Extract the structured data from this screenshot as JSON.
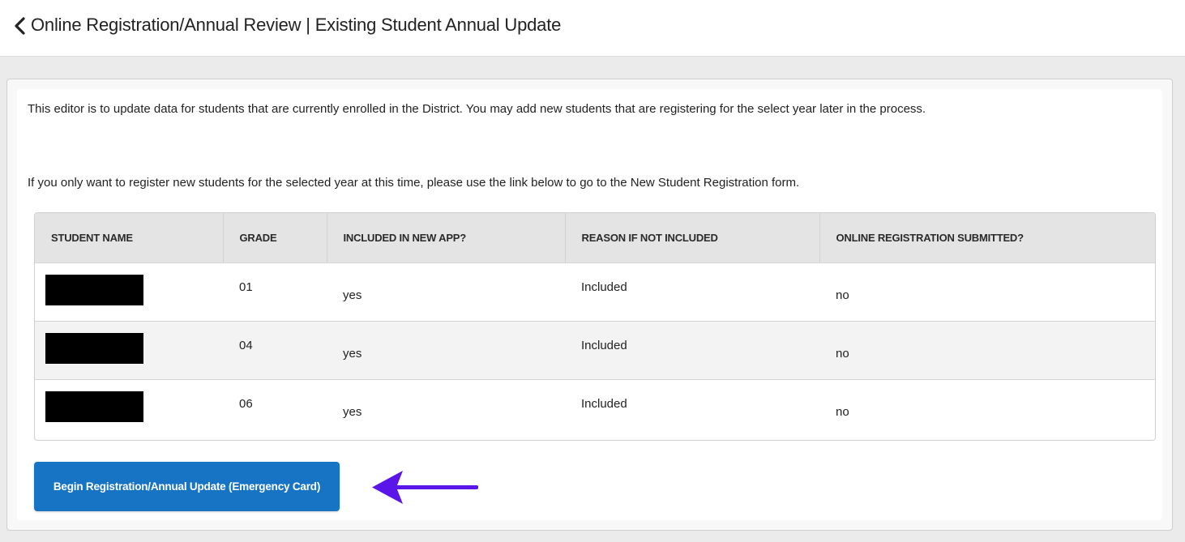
{
  "header": {
    "back_icon": "chevron-left-icon",
    "title": "Online Registration/Annual Review | Existing Student Annual Update"
  },
  "intro": {
    "line1": "This editor is to update data for students that are currently enrolled in the District. You may add new students that are registering for the select year later in the process.",
    "line2": "If you only want to register new students for the selected year at this time, please use the link below to go to the New Student Registration form."
  },
  "table": {
    "headers": [
      "STUDENT NAME",
      "GRADE",
      "INCLUDED IN NEW APP?",
      "REASON IF NOT INCLUDED",
      "ONLINE REGISTRATION SUBMITTED?"
    ],
    "rows": [
      {
        "grade": "01",
        "included": "yes",
        "reason": "Included",
        "submitted": "no"
      },
      {
        "grade": "04",
        "included": "yes",
        "reason": "Included",
        "submitted": "no"
      },
      {
        "grade": "06",
        "included": "yes",
        "reason": "Included",
        "submitted": "no"
      }
    ]
  },
  "actions": {
    "begin_label": "Begin Registration/Annual Update (Emergency Card)",
    "annotation_arrow_icon": "left-arrow-icon"
  },
  "colors": {
    "button_blue": "#1774c5",
    "arrow_purple": "#5a16e8",
    "header_row": "#e4e4e4",
    "redaction": "#000000"
  }
}
